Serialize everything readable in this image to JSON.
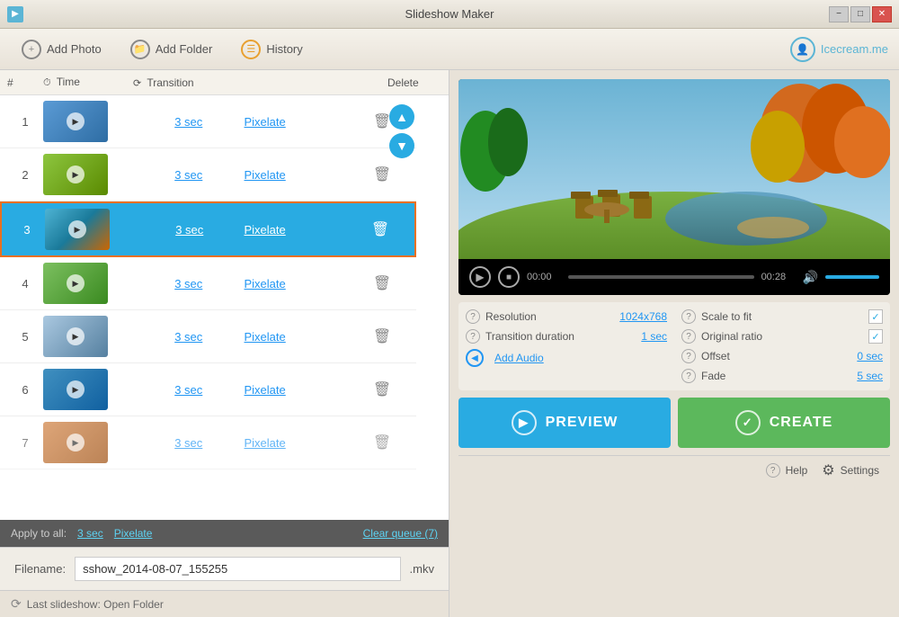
{
  "window": {
    "title": "Slideshow Maker",
    "min_label": "−",
    "restore_label": "□",
    "close_label": "✕"
  },
  "toolbar": {
    "add_photo_label": "Add Photo",
    "add_folder_label": "Add Folder",
    "history_label": "History",
    "brand_label": "Icecream.me"
  },
  "list_header": {
    "num": "#",
    "time": "Time",
    "transition": "Transition",
    "delete": "Delete"
  },
  "slides": [
    {
      "num": "1",
      "time": "3 sec",
      "transition": "Pixelate",
      "selected": false
    },
    {
      "num": "2",
      "time": "3 sec",
      "transition": "Pixelate",
      "selected": false
    },
    {
      "num": "3",
      "time": "3 sec",
      "transition": "Pixelate",
      "selected": true
    },
    {
      "num": "4",
      "time": "3 sec",
      "transition": "Pixelate",
      "selected": false
    },
    {
      "num": "5",
      "time": "3 sec",
      "transition": "Pixelate",
      "selected": false
    },
    {
      "num": "6",
      "time": "3 sec",
      "transition": "Pixelate",
      "selected": false
    },
    {
      "num": "7",
      "time": "3 sec",
      "transition": "Pixelate",
      "selected": false
    }
  ],
  "apply_bar": {
    "label": "Apply to all:",
    "time": "3 sec",
    "transition": "Pixelate",
    "clear": "Clear queue (7)"
  },
  "filename": {
    "label": "Filename:",
    "value": "sshow_2014-08-07_155255",
    "ext": ".mkv"
  },
  "status_bar": {
    "last_slideshow": "Last slideshow: Open Folder"
  },
  "video_controls": {
    "time_current": "00:00",
    "time_total": "00:28",
    "progress_pct": 0
  },
  "settings": {
    "resolution_label": "Resolution",
    "resolution_value": "1024x768",
    "transition_dur_label": "Transition duration",
    "transition_dur_value": "1 sec",
    "scale_label": "Scale to fit",
    "scale_checked": true,
    "ratio_label": "Original ratio",
    "ratio_checked": true,
    "offset_label": "Offset",
    "offset_value": "0 sec",
    "fade_label": "Fade",
    "fade_value": "5 sec",
    "add_audio_label": "Add Audio"
  },
  "buttons": {
    "preview_label": "PREVIEW",
    "create_label": "CREATE"
  },
  "bottom_right": {
    "help_label": "Help",
    "settings_label": "Settings"
  }
}
